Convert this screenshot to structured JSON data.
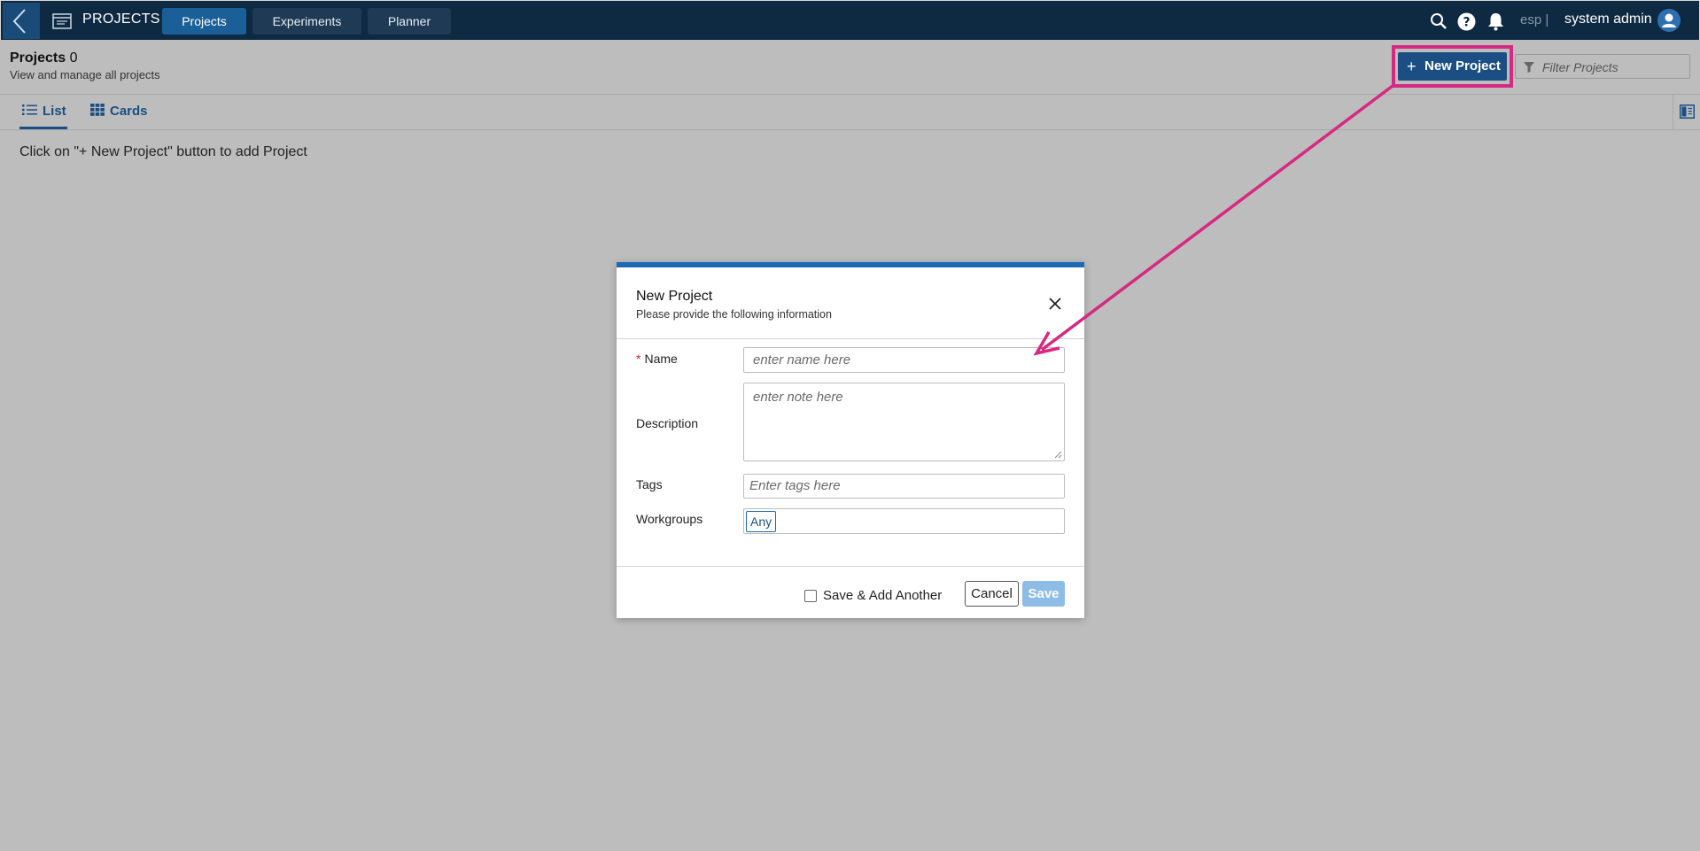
{
  "topbar": {
    "app_title": "PROJECTS",
    "tabs": [
      {
        "label": "Projects",
        "active": true
      },
      {
        "label": "Experiments",
        "active": false
      },
      {
        "label": "Planner",
        "active": false
      }
    ],
    "lang": "esp |",
    "user_name": "system admin",
    "icons": [
      "back-chevron-icon",
      "projects-app-icon",
      "search-icon",
      "help-icon",
      "bell-icon",
      "user-avatar-icon"
    ]
  },
  "header": {
    "title": "Projects",
    "count": "0",
    "subtitle": "View and manage all projects",
    "new_button_plus": "+",
    "new_button_label": "New Project",
    "filter_placeholder": "Filter Projects"
  },
  "views": {
    "list_label": "List",
    "cards_label": "Cards",
    "active": "List"
  },
  "empty_hint": "Click on \"+ New Project\" button to add Project",
  "modal": {
    "title": "New Project",
    "subtitle": "Please provide the following information",
    "required_mark": "*",
    "name_label": "Name",
    "name_placeholder": "enter name here",
    "description_label": "Description",
    "description_placeholder": "enter note here",
    "tags_label": "Tags",
    "tags_placeholder": "Enter tags here",
    "workgroups_label": "Workgroups",
    "workgroups_value": "Any",
    "save_add_another_label": "Save & Add Another",
    "cancel_label": "Cancel",
    "save_label": "Save"
  },
  "colors": {
    "topbar_bg": "#0e2a42",
    "accent": "#1b4f84",
    "highlight": "#d62982",
    "modal_top_border": "#1b6ab3",
    "overlay_bg": "#bdbdbd"
  }
}
